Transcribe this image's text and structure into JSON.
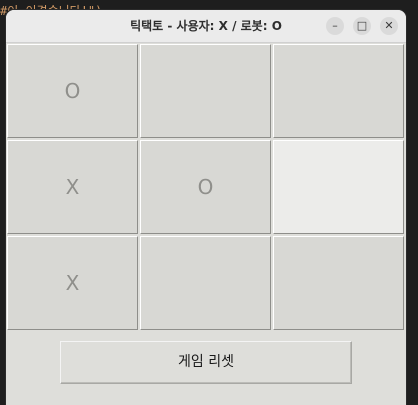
{
  "background": {
    "code_line": "#이 이겼습니다!\")"
  },
  "window": {
    "title": "틱택토 - 사용자: X / 로봇: O",
    "controls": {
      "minimize": "–",
      "maximize": "□",
      "close": "✕"
    }
  },
  "board": {
    "cells": [
      "O",
      "",
      "",
      "X",
      "O",
      "",
      "X",
      "",
      ""
    ]
  },
  "reset_button": {
    "label": "게임 리셋"
  },
  "colors": {
    "cell_bg": "#d8d8d4",
    "cell_hover_bg": "#ececea",
    "mark_color": "#8f8f8b",
    "titlebar_bg": "#ebebeb"
  }
}
